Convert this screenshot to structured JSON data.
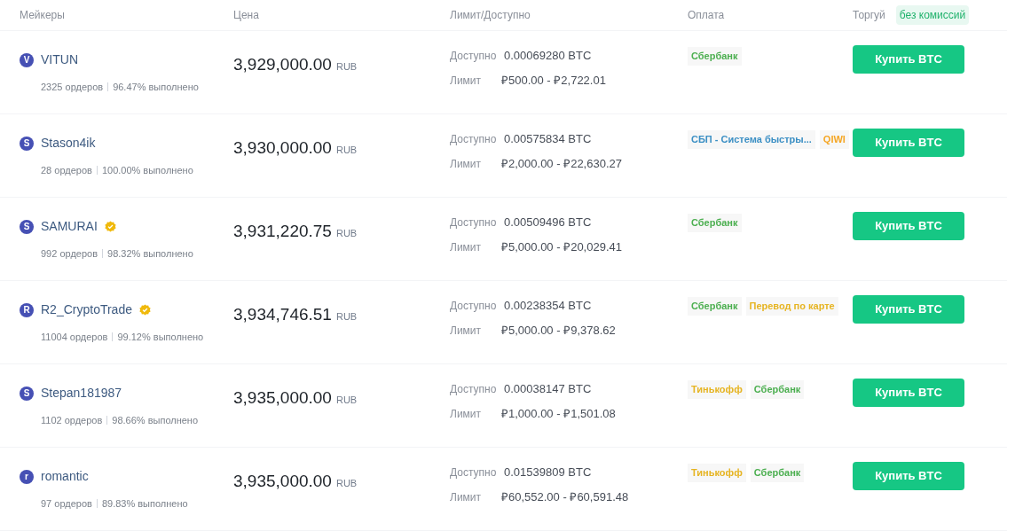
{
  "columns": [
    "Мейкеры",
    "Цена",
    "Лимит/Доступно",
    "Оплата",
    "Торгуй"
  ],
  "fee_badge": "без комиссий",
  "rows": [
    {
      "avatar": "V",
      "name": "VITUN",
      "verified": false,
      "orders": "2325 ордеров",
      "completion": "96.47% выполнено",
      "price": "3,929,000.00",
      "currency": "RUB",
      "available_label": "Доступно",
      "available": "0.00069280 BTC",
      "limit_label": "Лимит",
      "limit": "₽500.00 - ₽2,722.01",
      "payments": [
        {
          "label": "Сбербанк",
          "color": "#4caf50"
        }
      ],
      "button": "Купить BTC"
    },
    {
      "avatar": "S",
      "name": "Stason4ik",
      "verified": false,
      "orders": "28 ордеров",
      "completion": "100.00% выполнено",
      "price": "3,930,000.00",
      "currency": "RUB",
      "available_label": "Доступно",
      "available": "0.00575834 BTC",
      "limit_label": "Лимит",
      "limit": "₽2,000.00 - ₽22,630.27",
      "payments": [
        {
          "label": "СБП - Система быстры...",
          "color": "#3b8fc4"
        },
        {
          "label": "QIWI",
          "color": "#f5a623"
        }
      ],
      "button": "Купить BTC"
    },
    {
      "avatar": "S",
      "name": "SAMURAI",
      "verified": true,
      "orders": "992 ордеров",
      "completion": "98.32% выполнено",
      "price": "3,931,220.75",
      "currency": "RUB",
      "available_label": "Доступно",
      "available": "0.00509496 BTC",
      "limit_label": "Лимит",
      "limit": "₽5,000.00 - ₽20,029.41",
      "payments": [
        {
          "label": "Сбербанк",
          "color": "#4caf50"
        }
      ],
      "button": "Купить BTC"
    },
    {
      "avatar": "R",
      "name": "R2_CryptoTrade",
      "verified": true,
      "orders": "11004 ордеров",
      "completion": "99.12% выполнено",
      "price": "3,934,746.51",
      "currency": "RUB",
      "available_label": "Доступно",
      "available": "0.00238354 BTC",
      "limit_label": "Лимит",
      "limit": "₽5,000.00 - ₽9,378.62",
      "payments": [
        {
          "label": "Сбербанк",
          "color": "#4caf50"
        },
        {
          "label": "Перевод по карте",
          "color": "#e6b422"
        }
      ],
      "button": "Купить BTC"
    },
    {
      "avatar": "S",
      "name": "Stepan181987",
      "verified": false,
      "orders": "1102 ордеров",
      "completion": "98.66% выполнено",
      "price": "3,935,000.00",
      "currency": "RUB",
      "available_label": "Доступно",
      "available": "0.00038147 BTC",
      "limit_label": "Лимит",
      "limit": "₽1,000.00 - ₽1,501.08",
      "payments": [
        {
          "label": "Тинькофф",
          "color": "#e6b422"
        },
        {
          "label": "Сбербанк",
          "color": "#4caf50"
        }
      ],
      "button": "Купить BTC"
    },
    {
      "avatar": "r",
      "name": "romantic",
      "verified": false,
      "orders": "97 ордеров",
      "completion": "89.83% выполнено",
      "price": "3,935,000.00",
      "currency": "RUB",
      "available_label": "Доступно",
      "available": "0.01539809 BTC",
      "limit_label": "Лимит",
      "limit": "₽60,552.00 - ₽60,591.48",
      "payments": [
        {
          "label": "Тинькофф",
          "color": "#e6b422"
        },
        {
          "label": "Сбербанк",
          "color": "#4caf50"
        }
      ],
      "button": "Купить BTC"
    }
  ]
}
